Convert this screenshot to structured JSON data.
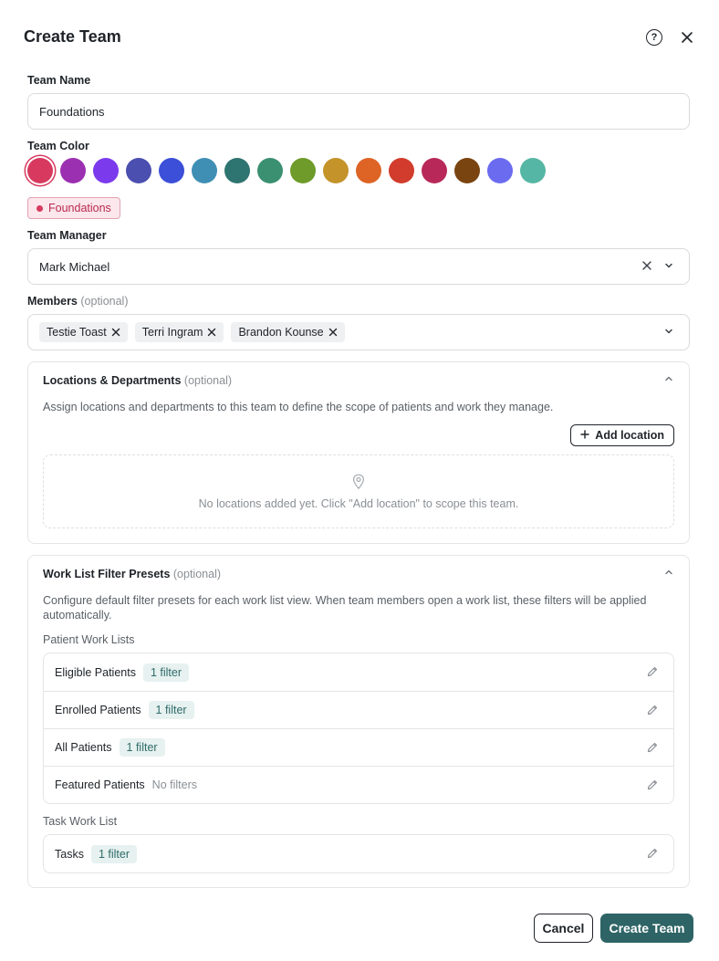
{
  "dialog": {
    "title": "Create Team"
  },
  "team_name": {
    "label": "Team Name",
    "value": "Foundations"
  },
  "team_color": {
    "label": "Team Color",
    "selected": "#d7395f",
    "swatches": [
      "#d7395f",
      "#9b30b0",
      "#7c3aed",
      "#4b4fb0",
      "#3b4fd8",
      "#3f8fb5",
      "#2e7470",
      "#3a9071",
      "#6e9b2a",
      "#c4932a",
      "#de6426",
      "#d23c2c",
      "#b8295a",
      "#7a4411",
      "#6b6bf0",
      "#56b6a5"
    ]
  },
  "preview": {
    "label": "Foundations"
  },
  "manager": {
    "label": "Team Manager",
    "value": "Mark Michael"
  },
  "members": {
    "label": "Members",
    "optional": "(optional)",
    "chips": [
      "Testie Toast",
      "Terri Ingram",
      "Brandon Kounse"
    ]
  },
  "locations": {
    "title": "Locations & Departments",
    "optional": "(optional)",
    "description": "Assign locations and departments to this team to define the scope of patients and work they manage.",
    "add_label": "Add location",
    "empty_message": "No locations added yet. Click \"Add location\" to scope this team."
  },
  "presets": {
    "title": "Work List Filter Presets",
    "optional": "(optional)",
    "description": "Configure default filter presets for each work list view. When team members open a work list, these filters will be applied automatically.",
    "patient_heading": "Patient Work Lists",
    "patient_lists": [
      {
        "name": "Eligible Patients",
        "filter": "1 filter"
      },
      {
        "name": "Enrolled Patients",
        "filter": "1 filter"
      },
      {
        "name": "All Patients",
        "filter": "1 filter"
      },
      {
        "name": "Featured Patients",
        "none": "No filters"
      }
    ],
    "task_heading": "Task Work List",
    "task_lists": [
      {
        "name": "Tasks",
        "filter": "1 filter"
      }
    ]
  },
  "footer": {
    "cancel": "Cancel",
    "create": "Create Team"
  }
}
